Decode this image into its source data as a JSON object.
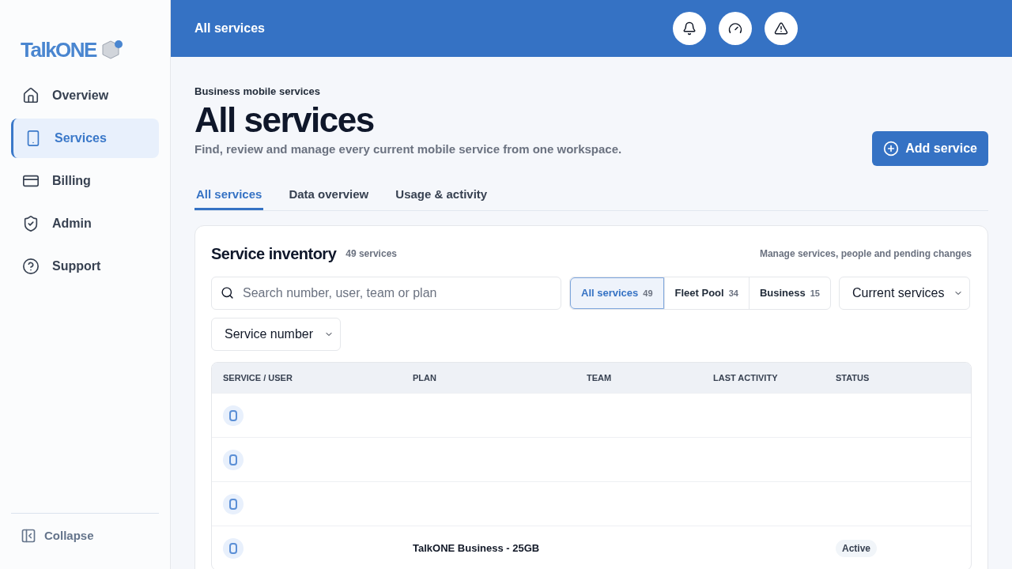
{
  "sidebar": {
    "logo": "TalkONE",
    "items": [
      {
        "label": "Overview",
        "kind": "home",
        "selected": false
      },
      {
        "label": "Services",
        "kind": "phone",
        "selected": true
      },
      {
        "label": "Billing",
        "kind": "card",
        "selected": false
      },
      {
        "label": "Admin",
        "kind": "shield",
        "selected": false
      },
      {
        "label": "Support",
        "kind": "help",
        "selected": false
      }
    ],
    "collapse": "Collapse"
  },
  "topbar": {
    "title": "All services"
  },
  "header": {
    "eyebrow": "Business mobile services",
    "title": "All services",
    "subtitle": "Find, review and manage every current mobile service from one workspace.",
    "add_button": "Add service"
  },
  "tabs": [
    {
      "label": "All services",
      "selected": true
    },
    {
      "label": "Data overview",
      "selected": false
    },
    {
      "label": "Usage & activity",
      "selected": false
    }
  ],
  "inventory": {
    "title": "Service inventory",
    "count": "49 services",
    "hint": "Manage services, people and pending changes",
    "search": {
      "placeholder": "Search number, user, team or plan"
    },
    "segments": [
      {
        "label": "All services",
        "count": "49",
        "selected": true
      },
      {
        "label": "Fleet Pool",
        "count": "34",
        "selected": false
      },
      {
        "label": "Business",
        "count": "15",
        "selected": false
      }
    ],
    "scope_select": "Current services",
    "sort_select": "Service number",
    "table": {
      "columns": [
        "SERVICE / USER",
        "PLAN",
        "TEAM",
        "LAST ACTIVITY",
        "STATUS"
      ],
      "rows": [
        {},
        {},
        {},
        {
          "plan": "TalkONE Business - 25GB",
          "status": "Active"
        }
      ]
    }
  }
}
